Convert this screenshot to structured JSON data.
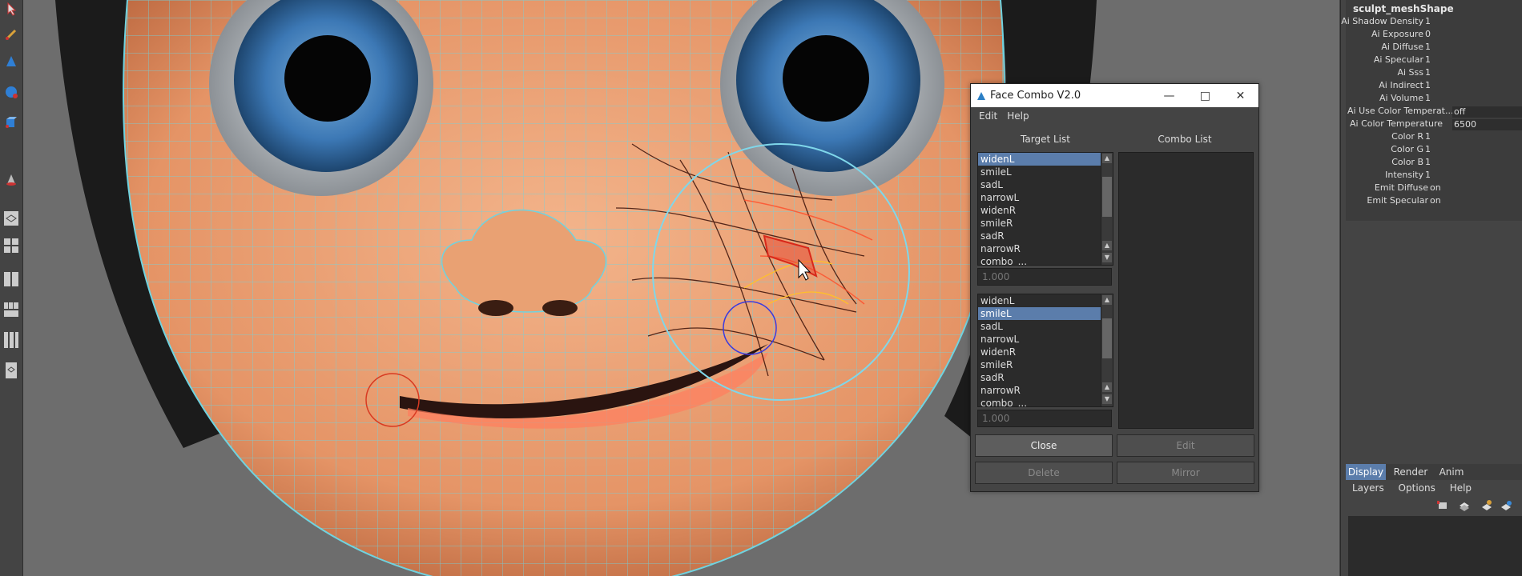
{
  "dialog": {
    "title": "Face Combo V2.0",
    "menu": [
      "Edit",
      "Help"
    ],
    "target_list_header": "Target List",
    "combo_list_header": "Combo List",
    "list1": {
      "items": [
        "widenL",
        "smileL",
        "sadL",
        "narrowL",
        "widenR",
        "smileR",
        "sadR",
        "narrowR",
        "combo_..."
      ],
      "selected": "widenL"
    },
    "value1": "1.000",
    "list2": {
      "items": [
        "widenL",
        "smileL",
        "sadL",
        "narrowL",
        "widenR",
        "smileR",
        "sadR",
        "narrowR",
        "combo_..."
      ],
      "selected": "smileL"
    },
    "value2": "1.000",
    "buttons": {
      "close": "Close",
      "edit": "Edit",
      "delete": "Delete",
      "mirror": "Mirror"
    }
  },
  "attr_panel": {
    "title": "sculpt_meshShape",
    "rows": [
      {
        "label": "Ai Shadow Density",
        "value": "1"
      },
      {
        "label": "Ai Exposure",
        "value": "0"
      },
      {
        "label": "Ai Diffuse",
        "value": "1"
      },
      {
        "label": "Ai Specular",
        "value": "1"
      },
      {
        "label": "Ai Sss",
        "value": "1"
      },
      {
        "label": "Ai Indirect",
        "value": "1"
      },
      {
        "label": "Ai Volume",
        "value": "1"
      },
      {
        "label": "Ai Use Color Temperat...",
        "value": "off"
      },
      {
        "label": "Ai Color Temperature",
        "value": "6500"
      },
      {
        "label": "Color R",
        "value": "1"
      },
      {
        "label": "Color G",
        "value": "1"
      },
      {
        "label": "Color B",
        "value": "1"
      },
      {
        "label": "Intensity",
        "value": "1"
      },
      {
        "label": "Emit Diffuse",
        "value": "on"
      },
      {
        "label": "Emit Specular",
        "value": "on"
      }
    ],
    "tabs": [
      "Display",
      "Render",
      "Anim"
    ],
    "active_tab": "Display",
    "submenu": [
      "Layers",
      "Options",
      "Help"
    ]
  },
  "colors": {
    "selection": "#5b7dab",
    "skin": "#e79a6f",
    "wire": "#6fd3e0",
    "iris": "#3f78b4"
  }
}
